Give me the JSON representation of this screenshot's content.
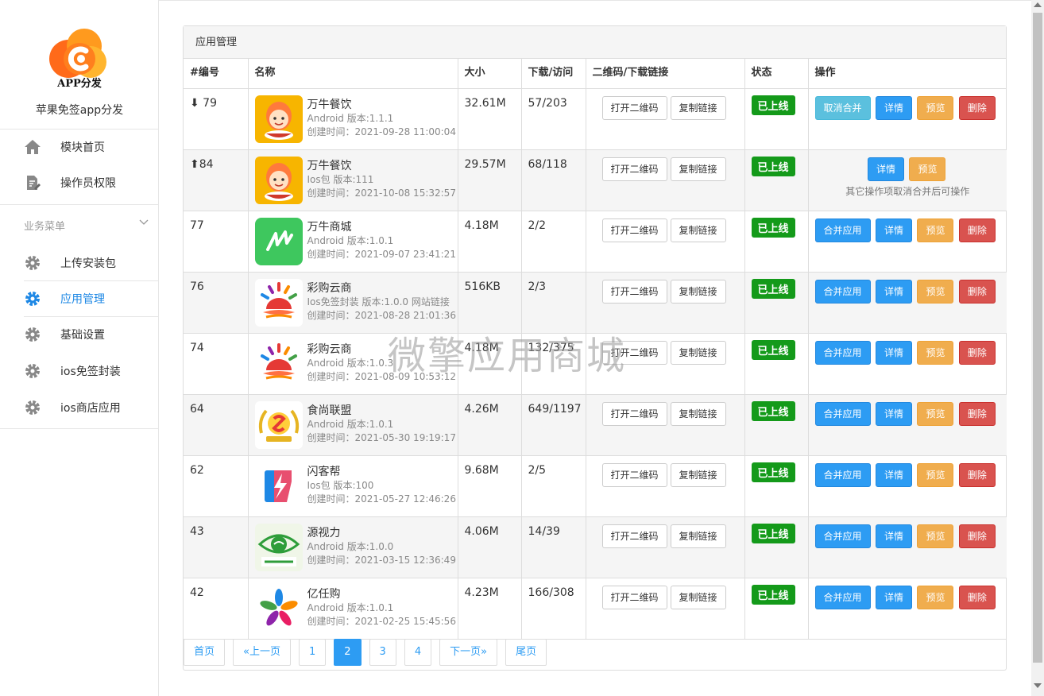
{
  "sidebar": {
    "logo_text": "APP分发",
    "brand": "苹果免签app分发",
    "items": [
      {
        "label": "模块首页",
        "icon": "home-icon"
      },
      {
        "label": "操作员权限",
        "icon": "edit-document-icon"
      }
    ],
    "section_title": "业务菜单",
    "menu": [
      {
        "label": "上传安装包",
        "icon": "gear-icon"
      },
      {
        "label": "应用管理",
        "icon": "gear-icon",
        "active": true
      },
      {
        "label": "基础设置",
        "icon": "gear-icon"
      },
      {
        "label": "ios免签封装",
        "icon": "gear-icon"
      },
      {
        "label": "ios商店应用",
        "icon": "gear-icon"
      }
    ]
  },
  "panel": {
    "title": "应用管理",
    "columns": [
      "#编号",
      "名称",
      "大小",
      "下载/访问",
      "二维码/下载链接",
      "状态",
      "操作"
    ]
  },
  "buttons": {
    "open_qr": "打开二维码",
    "copy_link": "复制链接",
    "unmerge": "取消合并",
    "merge": "合并应用",
    "detail": "详情",
    "preview": "预览",
    "delete": "删除",
    "status_online": "已上线",
    "merged_note": "其它操作项取消合并后可操作"
  },
  "rows": [
    {
      "id": "⬇ 79",
      "name": "万牛餐饮",
      "sub": "Android 版本:1.1.1",
      "created": "创建时间：2021-09-28 11:00:04",
      "size": "32.61M",
      "dl": "57/203",
      "icon": "chef-icon",
      "mode": "unmerge"
    },
    {
      "id": "⬆84",
      "name": "万牛餐饮",
      "sub": "Ios包 版本:111",
      "created": "创建时间：2021-10-08 15:32:57",
      "size": "29.57M",
      "dl": "68/118",
      "icon": "chef-icon",
      "mode": "merged"
    },
    {
      "id": "77",
      "name": "万牛商城",
      "sub": "Android 版本:1.0.1",
      "created": "创建时间：2021-09-07 23:41:21",
      "size": "4.18M",
      "dl": "2/2",
      "icon": "green-logo-icon",
      "mode": "normal"
    },
    {
      "id": "76",
      "name": "彩购云商",
      "sub": "Ios免签封装 版本:1.0.0 网站链接",
      "created": "创建时间：2021-08-28 21:01:36",
      "size": "516KB",
      "dl": "2/3",
      "icon": "sun-logo-icon",
      "mode": "normal"
    },
    {
      "id": "74",
      "name": "彩购云商",
      "sub": "Android 版本:1.0.3",
      "created": "创建时间：2021-08-09 10:53:12",
      "size": "4.18M",
      "dl": "132/375",
      "icon": "sun-logo-icon",
      "mode": "normal"
    },
    {
      "id": "64",
      "name": "食尚联盟",
      "sub": "Android 版本:1.0.1",
      "created": "创建时间：2021-05-30 19:19:17",
      "size": "4.26M",
      "dl": "649/1197",
      "icon": "gold-emblem-icon",
      "mode": "normal"
    },
    {
      "id": "62",
      "name": "闪客帮",
      "sub": "Ios包 版本:100",
      "created": "创建时间：2021-05-27 12:46:26",
      "size": "9.68M",
      "dl": "2/5",
      "icon": "lightning-logo-icon",
      "mode": "normal"
    },
    {
      "id": "43",
      "name": "源视力",
      "sub": "Android 版本:1.0.0",
      "created": "创建时间：2021-03-15 12:36:49",
      "size": "4.06M",
      "dl": "14/39",
      "icon": "eye-logo-icon",
      "mode": "normal"
    },
    {
      "id": "42",
      "name": "亿任购",
      "sub": "Android 版本:1.0.1",
      "created": "创建时间：2021-02-25 15:45:56",
      "size": "4.23M",
      "dl": "166/308",
      "icon": "pinwheel-logo-icon",
      "mode": "normal"
    }
  ],
  "pagination": [
    "首页",
    "«上一页",
    "1",
    "2",
    "3",
    "4",
    "下一页»",
    "尾页"
  ],
  "pagination_active": "2",
  "watermark": "微擎应用商城",
  "colors": {
    "accent": "#2d9cf3",
    "online": "#149a1a",
    "warning": "#f0ad4e",
    "danger": "#d9534f",
    "info": "#5bc0de"
  }
}
